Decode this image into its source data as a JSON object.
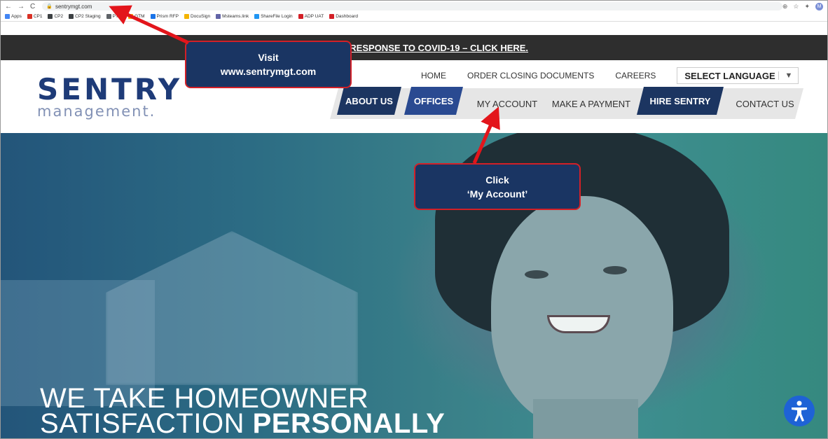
{
  "browser": {
    "nav": {
      "back": "←",
      "forward": "→",
      "reload": "C"
    },
    "url": "sentrymgt.com",
    "right_icons": [
      "⊕",
      "☆",
      "✦"
    ],
    "profile_initial": "M",
    "bookmarks": [
      {
        "label": "Apps",
        "color": "#4285f4"
      },
      {
        "label": "CP1",
        "color": "#d93025"
      },
      {
        "label": "CP2",
        "color": "#3c4043"
      },
      {
        "label": "CP2 Staging",
        "color": "#3c4043"
      },
      {
        "label": "PTW",
        "color": "#5f6368"
      },
      {
        "label": "GTM",
        "color": "#f9ab00"
      },
      {
        "label": "Prism RFP",
        "color": "#1a73e8"
      },
      {
        "label": "DocuSign",
        "color": "#f4b400"
      },
      {
        "label": "Msteams.link",
        "color": "#6264a7"
      },
      {
        "label": "ShareFile Login",
        "color": "#2196f3"
      },
      {
        "label": "ADP UAT",
        "color": "#d32027"
      },
      {
        "label": "Dashboard",
        "color": "#d32027"
      }
    ]
  },
  "banner": {
    "text": "VIEW OUR RESPONSE TO COVID-19 – CLICK HERE."
  },
  "logo": {
    "top": "SENTRY",
    "bottom": "management."
  },
  "top_nav": {
    "home": "HOME",
    "order_docs": "ORDER CLOSING DOCUMENTS",
    "careers": "CAREERS",
    "language": "SELECT LANGUAGE",
    "language_arrow": "▼"
  },
  "main_nav": {
    "about": "ABOUT US",
    "offices": "OFFICES",
    "my_account": "MY ACCOUNT",
    "make_payment": "MAKE A PAYMENT",
    "hire": "HIRE SENTRY",
    "contact": "CONTACT US"
  },
  "hero": {
    "line1": "WE TAKE HOMEOWNER",
    "line2_regular": "SATISFACTION ",
    "line2_bold": "PERSONALLY"
  },
  "accessibility_icon": "accessibility-icon",
  "callouts": {
    "visit": {
      "line1": "Visit",
      "line2": "www.sentrymgt.com"
    },
    "click": {
      "line1": "Click",
      "line2": "‘My Account’"
    }
  },
  "colors": {
    "navy": "#1c3561",
    "blue": "#2a4a91",
    "callout_border": "#d32027",
    "arrow": "#e3151b"
  }
}
